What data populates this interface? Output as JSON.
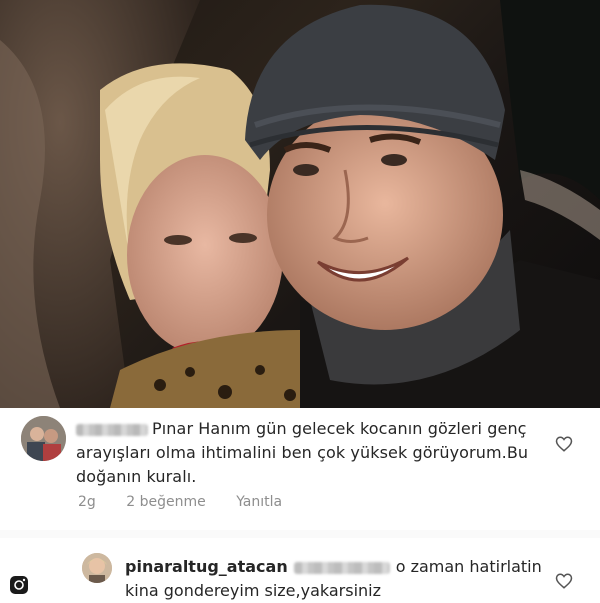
{
  "photo": {
    "icon": "couple-selfie-photo"
  },
  "comment1": {
    "avatar_icon": "user-avatar-icon",
    "text": "Pınar Hanım gün gelecek kocanın gözleri genç arayışları olma ihtimalini ben çok yüksek görüyorum.Bu doğanın kuralı.",
    "time": "2g",
    "likes": "2 beğenme",
    "reply": "Yanıtla",
    "like_icon": "heart-outline-icon"
  },
  "comment2": {
    "avatar_icon": "user-avatar-icon",
    "username": "pinaraltug_atacan",
    "text": "o zaman hatirlatin kina gondereyim size,yakarsiniz",
    "like_icon": "heart-outline-icon",
    "corner_icon": "instagram-icon"
  }
}
